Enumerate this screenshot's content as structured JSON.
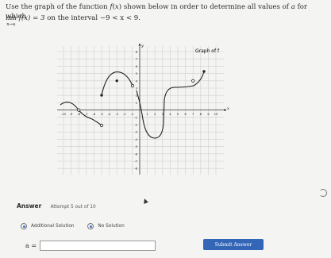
{
  "question": {
    "line1_a": "Use the graph of the function ",
    "line1_fx": "f",
    "line1_b": " shown below in order to determine all values of ",
    "line1_a_var": "a",
    "line1_c": " for which",
    "lim_word": "lim",
    "lim_sub": "x→a",
    "lim_expr": "f(x) = 3",
    "interval_text": " on the interval ",
    "interval": "−9 < x < 9."
  },
  "graph": {
    "title": "Graph of f",
    "y_axis_label": "y",
    "x_axis_label": "x",
    "x_ticks": [
      "-10",
      "-9",
      "-8",
      "-7",
      "-6",
      "-5",
      "-4",
      "-3",
      "-2",
      "-1",
      "1",
      "2",
      "3",
      "4",
      "5",
      "6",
      "7",
      "8",
      "9",
      "10"
    ],
    "y_ticks": [
      "8",
      "7",
      "6",
      "5",
      "4",
      "3",
      "2",
      "1",
      "-1",
      "-2",
      "-3",
      "-4",
      "-5",
      "-6",
      "-7",
      "-8"
    ]
  },
  "answer": {
    "label": "Answer",
    "attempt": "Attempt 5 out of 10",
    "option_additional": "Additional Solution",
    "option_none": "No Solution",
    "input_label": "a =",
    "input_value": "",
    "submit_label": "Submit Answer"
  }
}
